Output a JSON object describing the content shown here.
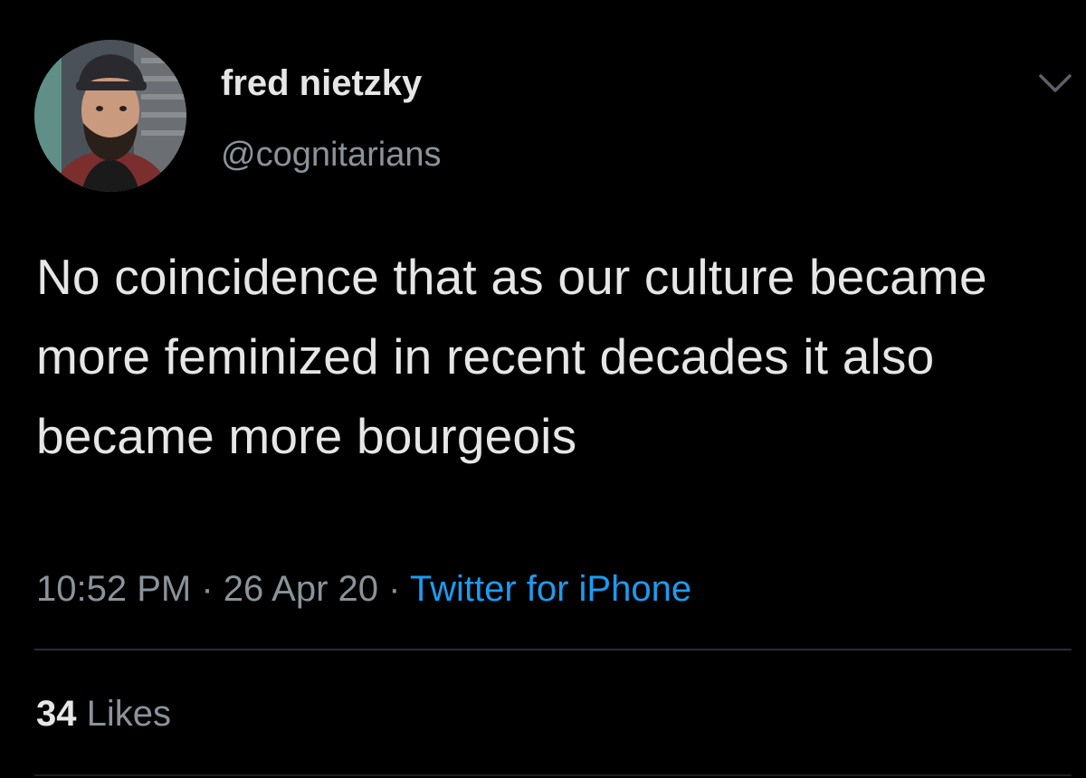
{
  "author": {
    "display_name": "fred nietzky",
    "handle": "@cognitarians"
  },
  "tweet": {
    "text": "No coincidence that as our culture became more feminized in recent decades it also became more bourgeois",
    "time": "10:52 PM",
    "separator": " · ",
    "date": "26 Apr 20",
    "source": "Twitter for iPhone"
  },
  "stats": {
    "likes_count": "34",
    "likes_label": " Likes"
  },
  "icons": {
    "menu": "chevron-down-icon",
    "avatar": "avatar"
  },
  "colors": {
    "background": "#000000",
    "text": "#e6e6e6",
    "muted": "#8b939a",
    "link": "#1d9bf0"
  }
}
